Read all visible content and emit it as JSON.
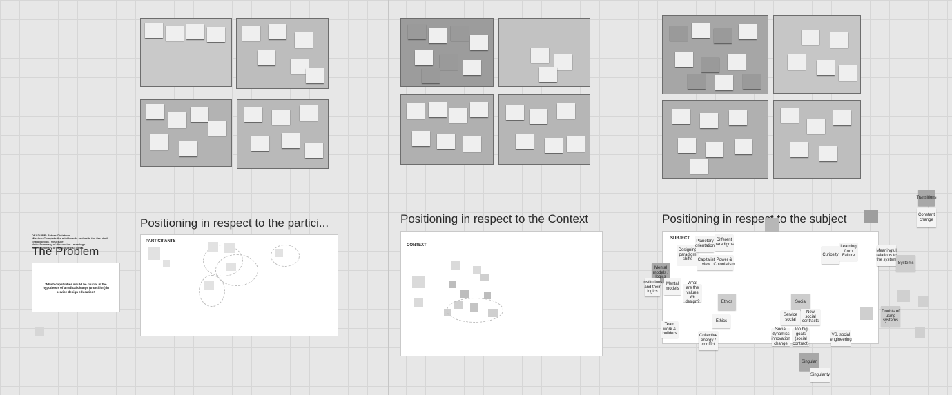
{
  "problem": {
    "deadline_text": "DEADLINE: Before Christmas\nMission: Complete the mini boards and write the first draft (introduction / structure)\nNote: Summary of discussion / meetings\nNote: Summary of key concepts / ideas",
    "title": "The Problem",
    "question": "Which capabilities would be crucial in the hypothesis of a radical change (transition) in service design education?"
  },
  "sections": [
    {
      "title": "Positioning in respect to the partici...",
      "panel_label": "PARTICIPANTS"
    },
    {
      "title": "Positioning in respect to the Context",
      "panel_label": "CONTEXT"
    },
    {
      "title": "Positioning in respect to the subject",
      "panel_label": "SUBJECT"
    }
  ],
  "subject_notes": [
    "Designing paradigm shifts",
    "Planetary orientation",
    "Different paradigms",
    "Capitalist view",
    "Power & Colonialism",
    "Curiosity",
    "Learning from Failure",
    "Mental models / logics",
    "Mental models",
    "What are the values we design?",
    "Ethics",
    "Ethics",
    "Social",
    "Service social",
    "New social contracts",
    "Collective energy / conflict",
    "Team work & builders",
    "Singular",
    "Singularity",
    "Meaningful relations to the system",
    "Systems",
    "Doubts of using systems",
    "Transitions",
    "Constant change",
    "Too big goals (social contract)",
    "VS. social engineering",
    "Social dynamics innovation change",
    "Institutions and their logics"
  ]
}
